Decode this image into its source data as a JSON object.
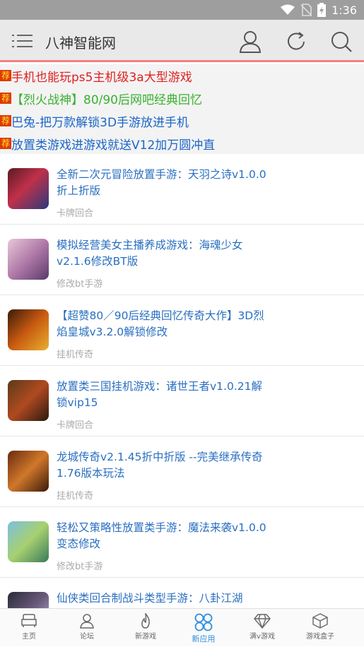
{
  "status": {
    "time": "1:36",
    "icons": [
      "wifi-icon",
      "no-sim-icon",
      "battery-charging-icon"
    ]
  },
  "header": {
    "title": "八神智能网",
    "icons": [
      "menu-icon",
      "user-icon",
      "refresh-icon",
      "search-icon"
    ]
  },
  "news": {
    "tag": "荐",
    "items": [
      {
        "text": "手机也能玩ps5主机级3a大型游戏",
        "color": "#e02020"
      },
      {
        "text": "【烈火战神】80/90后网吧经典回忆",
        "color": "#3ab030"
      },
      {
        "text": "巴兔-把万款解锁3D手游放进手机",
        "color": "#1a66c8"
      },
      {
        "text": "放置类游戏进游戏就送V12加万圆冲直",
        "color": "#1a66c8"
      }
    ]
  },
  "list": [
    {
      "title": "全新二次元冒险放置手游：天羽之诗v1.0.0折上折版",
      "category": "卡牌回合"
    },
    {
      "title": "模拟经营美女主播养成游戏：海魂少女v2.1.6修改BT版",
      "category": "修改bt手游"
    },
    {
      "title": "【超赞80／90后经典回忆传奇大作】3D烈焰皇城v3.2.0解锁修改",
      "category": "挂机传奇"
    },
    {
      "title": "放置类三国挂机游戏：诸世王者v1.0.21解锁vip15",
      "category": "卡牌回合"
    },
    {
      "title": "龙城传奇v2.1.45折中折版 --完美继承传奇1.76版本玩法",
      "category": "挂机传奇"
    },
    {
      "title": "轻松又策略性放置类手游：魔法来袭v1.0.0变态修改",
      "category": "修改bt手游"
    },
    {
      "title": "仙侠类回合制战斗类型手游：八卦江湖",
      "category": ""
    }
  ],
  "tabs": [
    {
      "label": "主页",
      "icon": "sofa-icon"
    },
    {
      "label": "论坛",
      "icon": "person-icon"
    },
    {
      "label": "新游戏",
      "icon": "flame-icon"
    },
    {
      "label": "新应用",
      "icon": "apps-icon"
    },
    {
      "label": "满v游戏",
      "icon": "diamond-icon"
    },
    {
      "label": "游戏盒子",
      "icon": "box-icon"
    }
  ],
  "colors": {
    "accent": "#2f8fe0",
    "news_tag": "#e03a00",
    "header_line": "#f08080"
  }
}
